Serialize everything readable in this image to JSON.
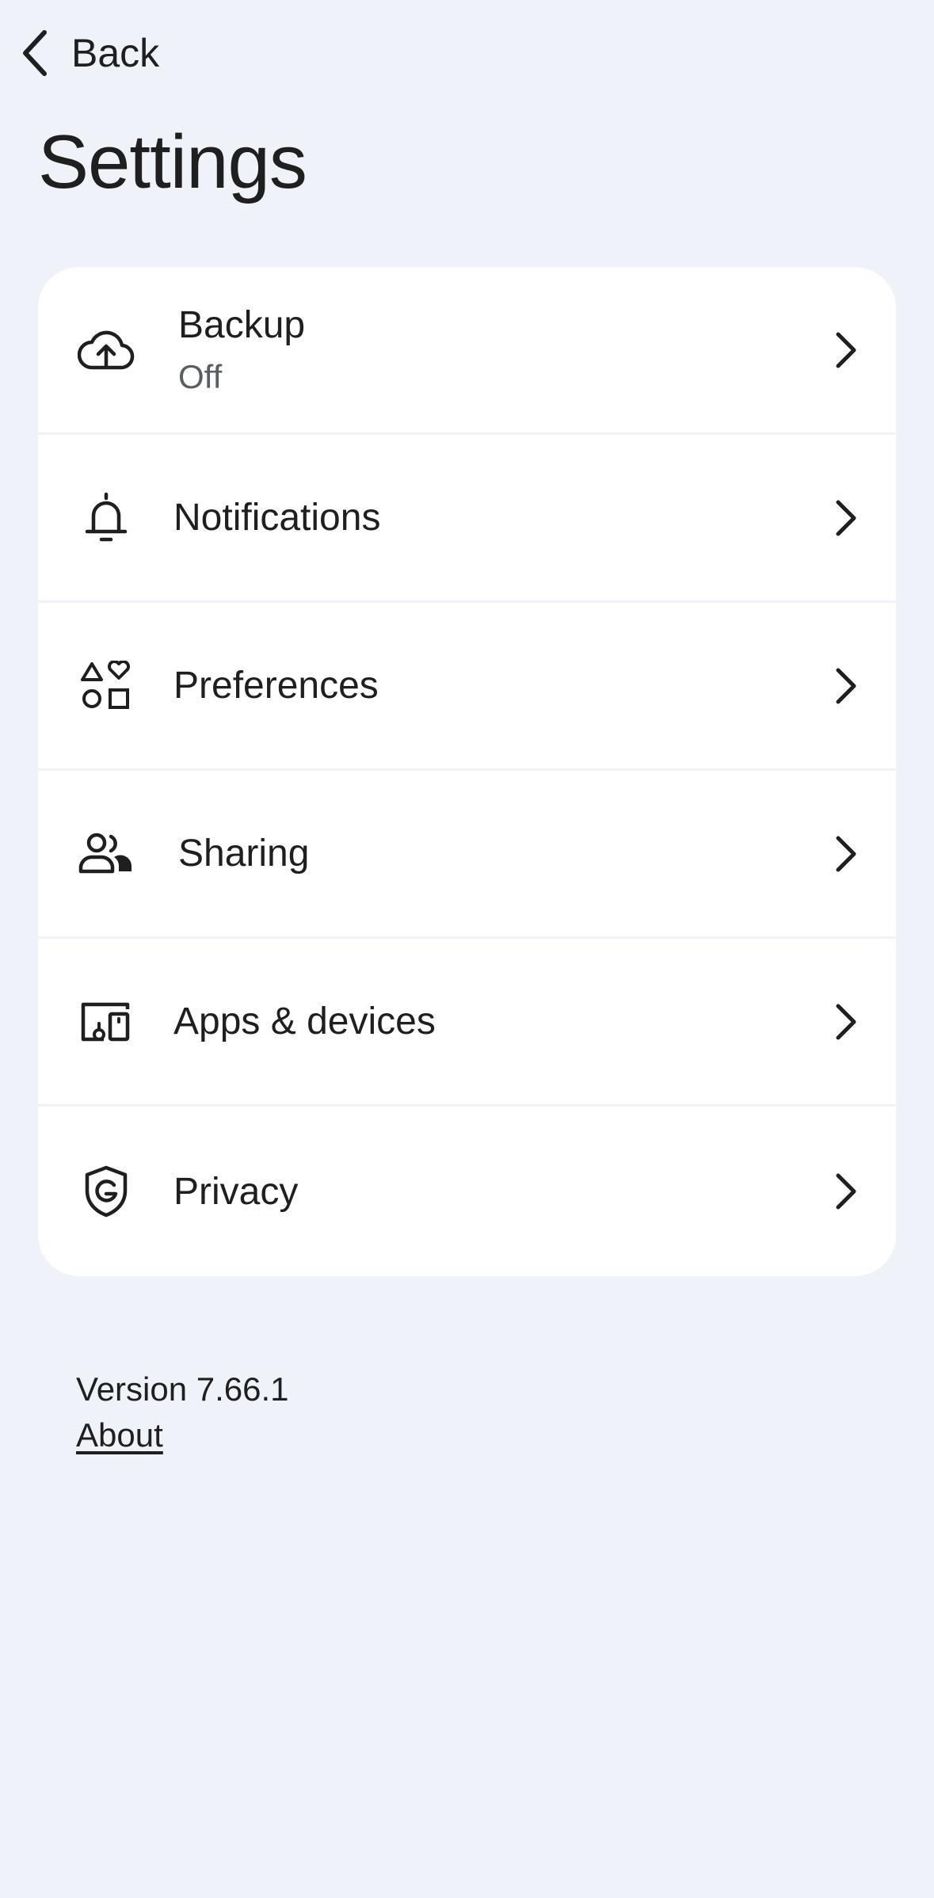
{
  "header": {
    "back_label": "Back",
    "back_icon": "chevron-left-icon",
    "title": "Settings"
  },
  "settings_list": {
    "items": [
      {
        "label": "Backup",
        "subtitle": "Off",
        "icon": "cloud-upload-icon"
      },
      {
        "label": "Notifications",
        "icon": "bell-icon"
      },
      {
        "label": "Preferences",
        "icon": "shapes-icon"
      },
      {
        "label": "Sharing",
        "icon": "people-icon"
      },
      {
        "label": "Apps & devices",
        "icon": "devices-icon"
      },
      {
        "label": "Privacy",
        "icon": "shield-g-icon"
      }
    ],
    "chevron_icon": "chevron-right-icon"
  },
  "footer": {
    "version": "Version 7.66.1",
    "about_label": "About"
  },
  "colors": {
    "background": "#eff2f8",
    "card": "#ffffff",
    "text": "#1f1f1f",
    "secondary_text": "#5a5d63"
  }
}
